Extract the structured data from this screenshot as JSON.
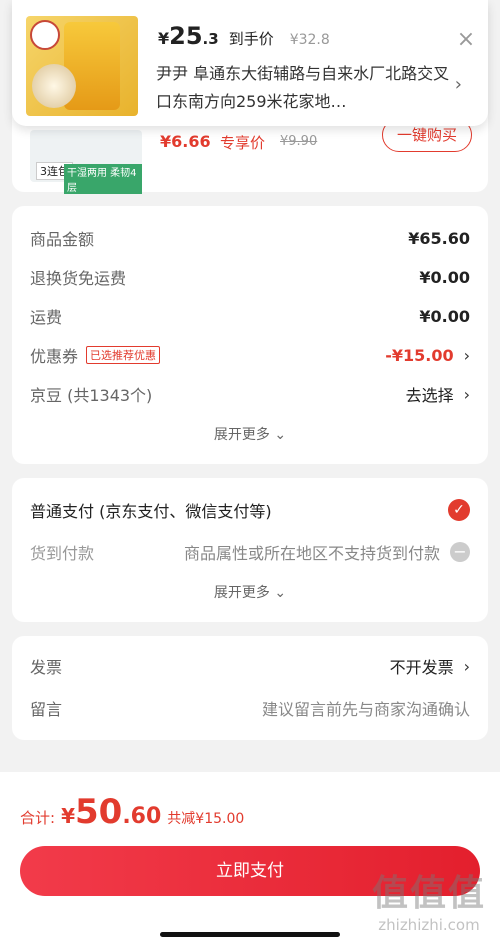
{
  "popup": {
    "price_currency": "¥",
    "price_int": "25",
    "price_dec": ".3",
    "price_label": "到手价",
    "old_price": "¥32.8",
    "close_icon": "×",
    "address": "尹尹  阜通东大街辅路与自来水厂北路交叉口东南方向259米花家地…"
  },
  "product": {
    "count_label": "3连包",
    "feature_label": "干湿两用 柔韧4层",
    "price": "¥6.66",
    "price_tag": "专享价",
    "old_price": "¥9.90",
    "buy_button": "一键购买"
  },
  "summary": {
    "rows": [
      {
        "label": "商品金额",
        "value": "¥65.60"
      },
      {
        "label": "退换货免运费",
        "value": "¥0.00"
      },
      {
        "label": "运费",
        "value": "¥0.00"
      },
      {
        "label": "优惠券",
        "badge": "已选推荐优惠",
        "value": "-¥15.00"
      },
      {
        "label": "京豆 (共1343个)",
        "value": "去选择"
      }
    ],
    "more": "展开更多 ⌄"
  },
  "payment": {
    "method": "普通支付 (京东支付、微信支付等)",
    "cod_label": "货到付款",
    "cod_note": "商品属性或所在地区不支持货到付款",
    "more": "展开更多 ⌄"
  },
  "extra": {
    "invoice_label": "发票",
    "invoice_value": "不开发票",
    "note_label": "留言",
    "note_placeholder": "建议留言前先与商家沟通确认"
  },
  "footer": {
    "total_label": "合计:",
    "currency": "¥",
    "total_int": "50",
    "total_dec": ".60",
    "save_text": "共减¥15.00",
    "pay_button": "立即支付"
  },
  "watermark": {
    "line1": "值值值",
    "line2": "zhizhizhi.com"
  },
  "colors": {
    "accent": "#e23b2e",
    "background": "#f2f2f2"
  }
}
